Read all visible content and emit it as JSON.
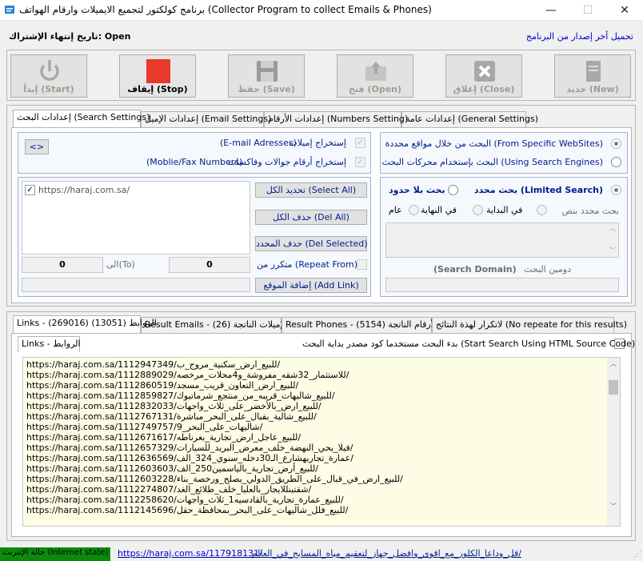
{
  "window": {
    "title": "برنامج كولكتور لتجميع الايميلات وارقام الهواتف (Collector Program to collect Emails & Phones)",
    "minimize": "—",
    "maximize": "☐",
    "close": "✕"
  },
  "info": {
    "update_link": "تحميل أخر إصدار من البرنامج",
    "expiry_label": "تاريخ إنتهاء الإشتراك: Open"
  },
  "toolbar": {
    "new": "جديد (New)",
    "close": "إغلاق (Close)",
    "open": "فتح (Open)",
    "save": "حفظ (Save)",
    "stop": "إيقاف (Stop)",
    "start": "إبدأ (Start)"
  },
  "settings_tabs": [
    "إعدادات عامة (General Settings)",
    "إعدادات الأرقام (Numbers Setting)",
    "إعدادات الإميل (Email Settings)",
    "إعدادات البحث (Search Settings)"
  ],
  "search": {
    "from_websites": "البحث من خلال مواقع محددة (From Specific WebSites)",
    "using_engines": "البحث بإستخدام محركات البحث (Using Search Engines)",
    "limited": "بحث محدد (Limited Search)",
    "unlimited": "بحث بلا حدود",
    "search_text": "بحث محدد بنص",
    "at_start": "في البداية",
    "at_end": "في النهاية",
    "general": "عام",
    "domain_label": "دومين البحث",
    "domain_en": "(Search Domain)"
  },
  "extract": {
    "toggle": "<>",
    "emails_en": "(E-mail Adresses)",
    "emails_ar": "إستخراج إميلات",
    "numbers_en": "(Moblie/Fax Numbers)",
    "numbers_ar": "إستخراج أرقام جوالات وفاكسات"
  },
  "sites": {
    "list": [
      "https://haraj.com.sa/"
    ],
    "select_all": "تحديد الكل (Select All)",
    "del_all": "حذف الكل (Del All)",
    "del_selected": "حذف المحدد (Del Selected)",
    "repeat": "متكرر من (Repeat From)",
    "to_label": "الى(To)",
    "from_value": "0",
    "to_value": "0",
    "add_link": "إضافة الموقع (Add Link)"
  },
  "results_tabs": [
    "Links - الروابط (13051) (269016)",
    "Result Emails - الإميلات الناتجة (26)",
    "Result Phones - الأرقام الناتجة (5154)",
    "لاتكرار لهذة النتائج (No repeate for this results)"
  ],
  "inner_tab": "Links - الروابط",
  "html_source": "بدء البحث مستخدما كود مصدر بداية البحث (Start Search Using HTML Source Code)",
  "links": [
    "https://haraj.com.sa/1112947349/للبيع_ارض_سكنية_مروج_ب/",
    "https://haraj.com.sa/1112889029/للاستثمار_32شقه_مفروشة_و4محلات_مرخصه/",
    "https://haraj.com.sa/1112860519/للبيع_ارض_التعاون_قريب_مسجد/",
    "https://haraj.com.sa/1112859827/للبيع_شاليهات_قريبه_من_منتجع_شرماتيوك/",
    "https://haraj.com.sa/1112832033/للبيع_ارض_بالأخضر_على_ثلاث_واجهات/",
    "https://haraj.com.sa/1112767131/للبيع_شالية_بقبال_على_البحر_مباشرة/",
    "https://haraj.com.sa/1112749757/شاليهات_على_البحر_9/",
    "https://haraj.com.sa/1112671617/للبيع_عاجل_ارض_تجارية_بغرناطه/",
    "https://haraj.com.sa/1112657329/فيلا_يحي_النهضة_خلف_معرض_البريد_للسيارات/",
    "https://haraj.com.sa/1112636569/عمارة_تجاريهشارع_الـ30دخله_سنوي_324_الف/",
    "https://haraj.com.sa/1112603603/للبيع_أرض_تجارية_بالياسمين250_الف/",
    "https://haraj.com.sa/1112603228/للبيع_ارض_في_قبال_على_الطريق_الدولي_يصلح_ورخصة_بناء/",
    "https://haraj.com.sa/1112274807/شقتينللايجار_بالعليا_خلف_طلائع_الغد/",
    "https://haraj.com.sa/1112258620/للبيع_عمارة_تجارية_بالقادسيه1_ثلاث_واجهات/",
    "https://haraj.com.sa/1112145696/للبيع_فلل_شاليهات_على_البحر_بمحافظة_حقل/"
  ],
  "status": {
    "internet": "حالة الإنترنت (Internet state)",
    "marquee_url": "https://haraj.com.sa/117918131/",
    "marquee_text": "قل_وداعا_الكلور_مع_اقوى_وافضل_جهاز_لتعقيم_مياه_المسابح_في_العالم/"
  },
  "colors": {
    "accent_blue": "#001c8c",
    "stop_red": "#e8392a",
    "links_bg": "#fdfde6",
    "status_green": "#0c8a0c"
  }
}
